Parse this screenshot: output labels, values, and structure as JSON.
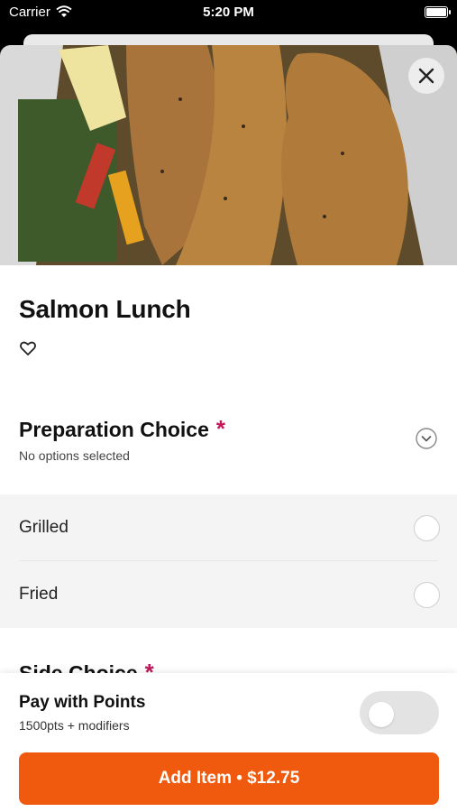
{
  "status_bar": {
    "carrier": "Carrier",
    "time": "5:20 PM"
  },
  "item": {
    "title": "Salmon Lunch"
  },
  "preparation": {
    "title": "Preparation Choice",
    "required_mark": "*",
    "subtitle": "No options selected",
    "options": [
      {
        "label": "Grilled"
      },
      {
        "label": "Fried"
      }
    ]
  },
  "side": {
    "title": "Side Choice",
    "required_mark": "*"
  },
  "points": {
    "title": "Pay with Points",
    "subtitle": "1500pts + modifiers"
  },
  "add_button": {
    "label": "Add Item • $12.75"
  },
  "colors": {
    "accent": "#f05a0e",
    "required": "#c2185b"
  }
}
